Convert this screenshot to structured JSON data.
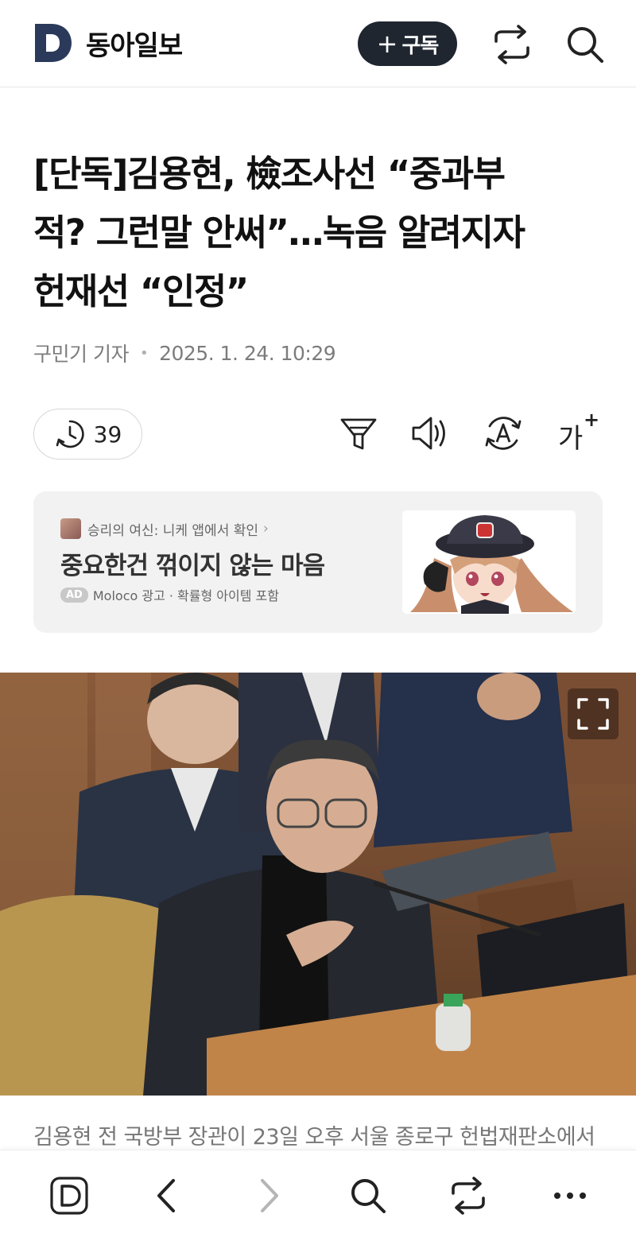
{
  "header": {
    "logo_letter": "D",
    "app_name": "동아일보",
    "subscribe_label": "구독",
    "icons": [
      "logo-d-icon",
      "share-icon",
      "search-icon"
    ]
  },
  "article": {
    "title_lines": [
      "[단독]김용현, 檢조사선 “중과부",
      "적? 그런말 안써”…녹음 알려지자",
      "헌재선 “인정”"
    ],
    "author": "구민기 기자",
    "date": "2025. 1. 24. 10:29",
    "history_count": "39",
    "tools": [
      "history-icon",
      "filter-icon",
      "speaker-icon",
      "translate-icon",
      "font-size-icon"
    ],
    "font_size_label": "가",
    "photo_caption": "김용현 전 국방부 장관이 23일 오후 서울 종로구 헌법재판소에서"
  },
  "ad": {
    "source": "승리의 여신: 니케 앱에서 확인",
    "headline": "중요한건 꺾이지 않는 마음",
    "badge": "AD",
    "meta": "Moloco 광고 · 확률형 아이템 포함"
  },
  "bottom_nav": {
    "items": [
      "home-d-icon",
      "back-icon",
      "forward-icon",
      "search-icon",
      "share-icon",
      "more-icon"
    ]
  },
  "colors": {
    "brand": "#2b3a5a",
    "subscribe_bg": "#1f2630",
    "text": "#111111",
    "muted": "#7c7c7c",
    "ad_bg": "#f2f2f3"
  }
}
